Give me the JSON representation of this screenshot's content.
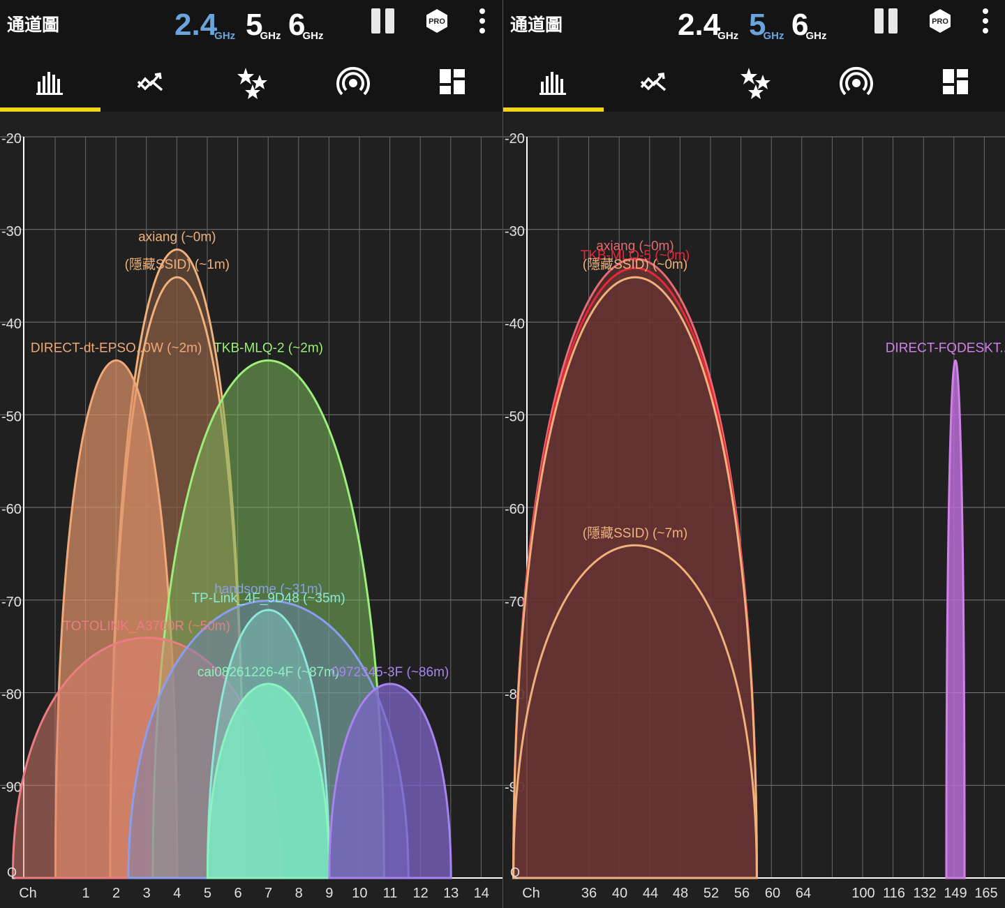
{
  "colors": {
    "accent_blue": "#6aa4dc",
    "tab_underline": "#f2d21b",
    "background": "#202020"
  },
  "panels": [
    {
      "id": "left",
      "title": "通道圖",
      "bands": [
        {
          "num": "2.4",
          "unit": "GHz",
          "active": true
        },
        {
          "num": "5",
          "unit": "GHz",
          "active": false
        },
        {
          "num": "6",
          "unit": "GHz",
          "active": false
        }
      ],
      "pro_label": "PRO",
      "tabs": [
        "bar-chart-icon",
        "trend-chart-icon",
        "stars-icon",
        "hotspot-icon",
        "dashboard-icon"
      ],
      "selected_tab": 0,
      "chart_data": {
        "type": "area",
        "y_ticks": [
          "-20",
          "-30",
          "-40",
          "-50",
          "-60",
          "-70",
          "-80",
          "-90"
        ],
        "ylim": [
          -100,
          -20
        ],
        "x_first_label": "Ch",
        "x_ticks": [
          "1",
          "2",
          "3",
          "4",
          "5",
          "6",
          "7",
          "8",
          "9",
          "10",
          "11",
          "12",
          "13",
          "14"
        ],
        "bottom_label": "Q",
        "series": [
          {
            "name": "axiang (~0m)",
            "channel": 4,
            "level": -32,
            "width": 2.2,
            "color": "#f0b27a",
            "fill": "#8a5b43",
            "alpha": 0.5
          },
          {
            "name": "(隱藏SSID) (~1m)",
            "channel": 4,
            "level": -35,
            "width": 2.2,
            "color": "#f0b27a",
            "fill": "#8a5b43",
            "alpha": 0.5
          },
          {
            "name": "DIRECT-dt-EPSO..0W (~2m)",
            "channel": 2,
            "level": -44,
            "width": 2.0,
            "color": "#f0a878",
            "fill": "#e0936a",
            "alpha": 0.7
          },
          {
            "name": "TKB-MLQ-2 (~2m)",
            "channel": 7,
            "level": -44,
            "width": 3.8,
            "color": "#9cf07a",
            "fill": "#7ab85a",
            "alpha": 0.55
          },
          {
            "name": "TOTOLINK_A3700R (~50m)",
            "channel": 3,
            "level": -74,
            "width": 4.4,
            "color": "#ec7c82",
            "fill": "#e08070",
            "alpha": 0.5
          },
          {
            "name": "handsome (~31m)",
            "channel": 7,
            "level": -70,
            "width": 4.6,
            "color": "#8a9ef0",
            "fill": "#6a86c0",
            "alpha": 0.45
          },
          {
            "name": "TP-Link_4F_9D48 (~35m)",
            "channel": 7,
            "level": -71,
            "width": 2.0,
            "color": "#8ce8d8",
            "fill": "#80c8c0",
            "alpha": 0.5
          },
          {
            "name": "cai08261226-4F (~87m)",
            "channel": 7,
            "level": -79,
            "width": 2.0,
            "color": "#8cf2c0",
            "fill": "#7ae8c0",
            "alpha": 0.85
          },
          {
            "name": "0972345-3F (~86m)",
            "channel": 11,
            "level": -79,
            "width": 2.0,
            "color": "#a884f0",
            "fill": "#7c64c8",
            "alpha": 0.75
          }
        ]
      }
    },
    {
      "id": "right",
      "title": "通道圖",
      "bands": [
        {
          "num": "2.4",
          "unit": "GHz",
          "active": false
        },
        {
          "num": "5",
          "unit": "GHz",
          "active": true
        },
        {
          "num": "6",
          "unit": "GHz",
          "active": false
        }
      ],
      "pro_label": "PRO",
      "tabs": [
        "bar-chart-icon",
        "trend-chart-icon",
        "stars-icon",
        "hotspot-icon",
        "dashboard-icon"
      ],
      "selected_tab": 0,
      "chart_data": {
        "type": "area",
        "y_ticks": [
          "-20",
          "-30",
          "-40",
          "-50",
          "-60",
          "-70",
          "-80",
          "-90"
        ],
        "ylim": [
          -100,
          -20
        ],
        "x_first_label": "Ch",
        "x_ticks": [
          "36",
          "40",
          "44",
          "48",
          "52",
          "56",
          "60",
          "64",
          "100",
          "116",
          "132",
          "149",
          "165"
        ],
        "bottom_label": "Q",
        "series": [
          {
            "name": "axiang (~0m)",
            "channel": 42,
            "level": -33,
            "width": 8.0,
            "color": "#e86a72",
            "fill": "#6a3434",
            "alpha": 0.6
          },
          {
            "name": "TKB-MLQ-5 (~0m)",
            "channel": 42,
            "level": -34,
            "width": 8.0,
            "color": "#e8283a",
            "fill": "#6a3434",
            "alpha": 0.6
          },
          {
            "name": "(隱藏SSID) (~0m)",
            "channel": 42,
            "level": -35,
            "width": 8.0,
            "color": "#f0b27a",
            "fill": "#6a3434",
            "alpha": 0.4
          },
          {
            "name": "(隱藏SSID) (~7m)",
            "channel": 42,
            "level": -64,
            "width": 8.0,
            "color": "#f0b27a",
            "fill": "#6a3434",
            "alpha": 0.3
          },
          {
            "name": "DIRECT-FQDESKT..PH",
            "channel": 149,
            "level": -44,
            "width": 0.6,
            "color": "#d080e8",
            "fill": "#c070e0",
            "alpha": 0.8
          }
        ]
      }
    }
  ]
}
